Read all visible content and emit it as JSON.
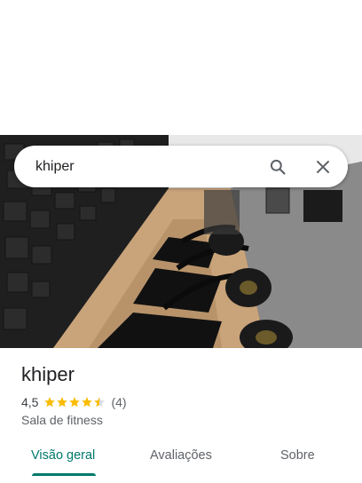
{
  "search": {
    "query": "khiper",
    "search_icon": "search-icon",
    "close_icon": "close-icon"
  },
  "place": {
    "name": "khiper",
    "rating": "4,5",
    "rating_value": 4.5,
    "stars_total": 5,
    "review_count": "(4)",
    "category": "Sala de fitness",
    "photo": "gym-photo"
  },
  "tabs": [
    {
      "label": "Visão geral",
      "active": true
    },
    {
      "label": "Avaliações",
      "active": false
    },
    {
      "label": "Sobre",
      "active": false
    }
  ],
  "colors": {
    "accent": "#00796b",
    "star": "#fbbc04",
    "star_empty": "#dadce0"
  }
}
